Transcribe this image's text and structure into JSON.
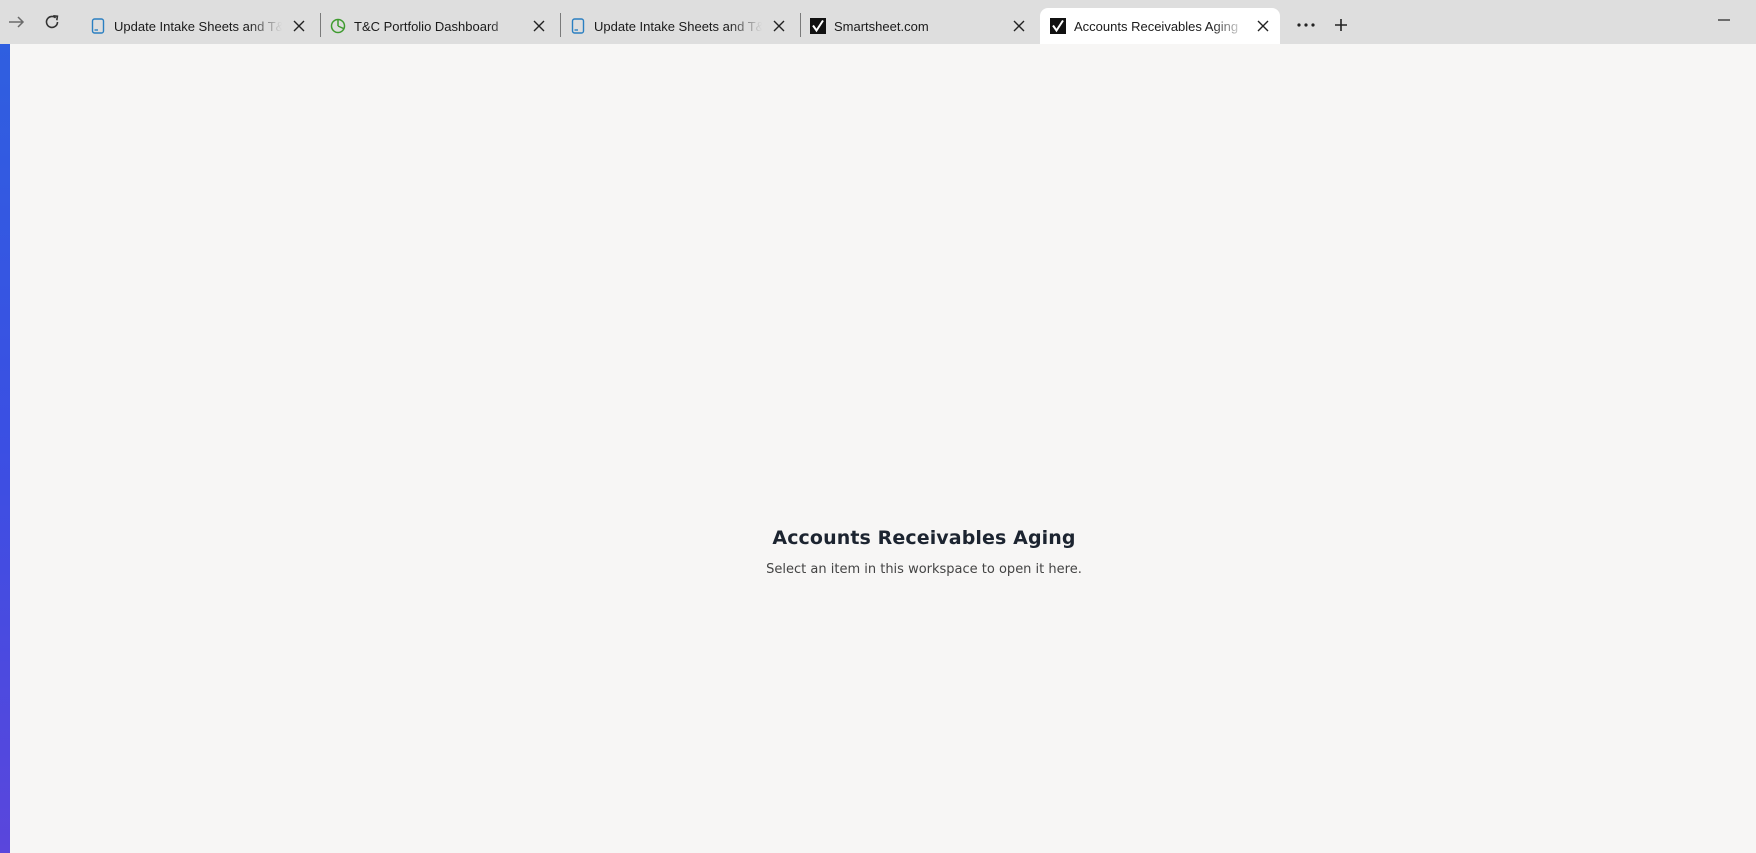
{
  "browser": {
    "tabs": [
      {
        "title": "Update Intake Sheets and T&C",
        "icon": "sheet-icon"
      },
      {
        "title": "T&C Portfolio Dashboard",
        "icon": "dashboard-icon"
      },
      {
        "title": "Update Intake Sheets and T&C",
        "icon": "sheet-icon"
      },
      {
        "title": "Smartsheet.com",
        "icon": "smartsheet-logo-icon"
      },
      {
        "title": "Accounts Receivables Aging",
        "icon": "smartsheet-logo-icon",
        "active": true
      }
    ],
    "colors": {
      "tabbar": "#dedede",
      "active_tab": "#ffffff",
      "sheet_icon": "#2a7fc1",
      "dashboard_icon": "#3f9b2f"
    }
  },
  "workspace": {
    "title": "Accounts Receivables Aging",
    "subtitle": "Select an item in this workspace to open it here."
  }
}
